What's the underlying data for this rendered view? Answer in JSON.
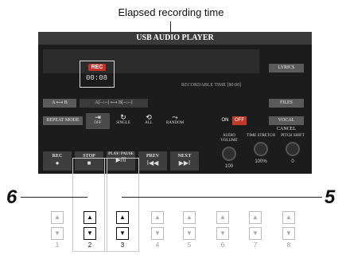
{
  "caption": "Elapsed recording time",
  "screen": {
    "title": "USB AUDIO PLAYER",
    "rec_badge": "REC",
    "elapsed": "00:08",
    "recordable": "RECORDABLE TIME [80:00]",
    "lyrics": "LYRICS",
    "ab_label": "A ⟷ B",
    "ab_values": "A[--:--] ⟷ B[--:--]",
    "files": "FILES",
    "repeat_mode": "REPEAT MODE",
    "modes": [
      {
        "icon": "⇥",
        "label": "OFF"
      },
      {
        "icon": "↻",
        "label": "SINGLE"
      },
      {
        "icon": "⟲",
        "label": "ALL"
      },
      {
        "icon": "⤳",
        "label": "RANDOM"
      }
    ],
    "on": "ON",
    "off": "OFF",
    "vocal_cancel": "VOCAL CANCEL",
    "knobs": [
      {
        "label": "AUDIO VOLUME",
        "value": "100"
      },
      {
        "label": "TIME STRETCH",
        "value": "100%"
      },
      {
        "label": "PITCH SHIFT",
        "value": "0"
      }
    ],
    "transport": [
      {
        "label": "REC",
        "icon": "●"
      },
      {
        "label": "STOP",
        "icon": "■"
      },
      {
        "label": "PLAY/ PAUSE",
        "icon": "▶/II"
      },
      {
        "label": "PREV",
        "icon": "I◀◀"
      },
      {
        "label": "NEXT",
        "icon": "▶▶I"
      }
    ]
  },
  "callouts": {
    "left": "6",
    "right": "5"
  },
  "hardware": {
    "up": "▲",
    "down": "▼",
    "numbers": [
      "1",
      "2",
      "3",
      "4",
      "5",
      "6",
      "7",
      "8"
    ]
  }
}
